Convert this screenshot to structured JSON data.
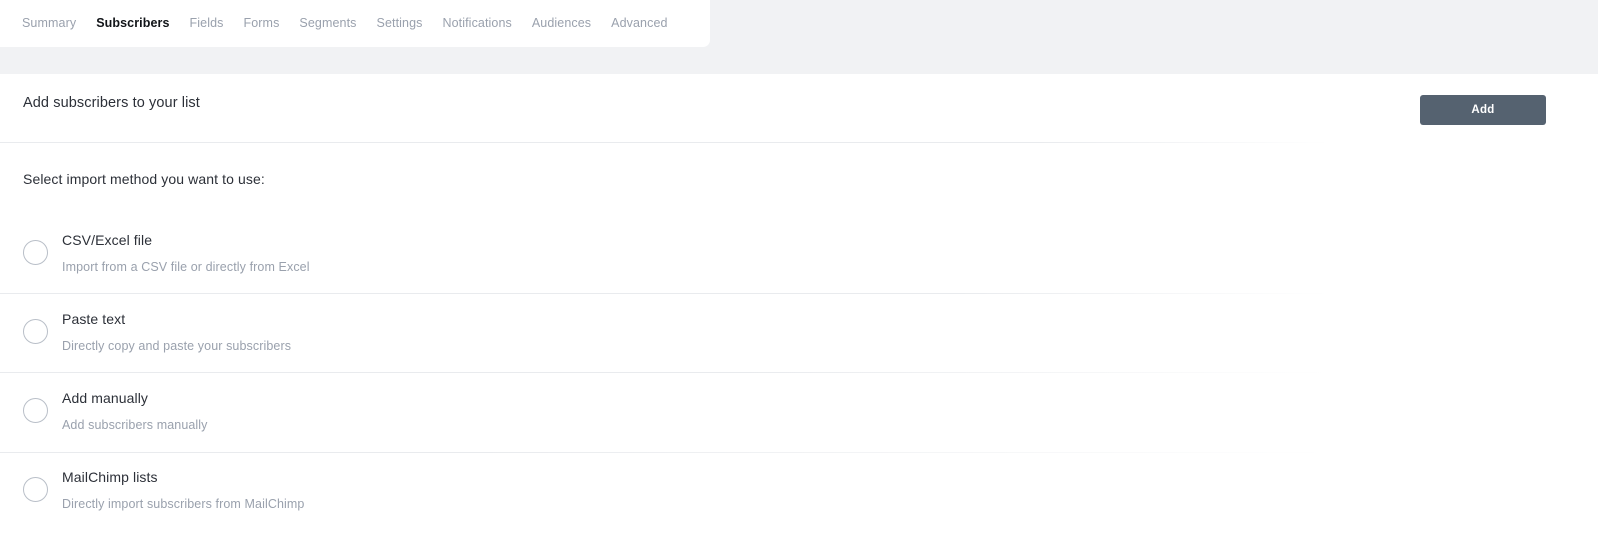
{
  "tabs": [
    {
      "label": "Summary",
      "active": false
    },
    {
      "label": "Subscribers",
      "active": true
    },
    {
      "label": "Fields",
      "active": false
    },
    {
      "label": "Forms",
      "active": false
    },
    {
      "label": "Segments",
      "active": false
    },
    {
      "label": "Settings",
      "active": false
    },
    {
      "label": "Notifications",
      "active": false
    },
    {
      "label": "Audiences",
      "active": false
    },
    {
      "label": "Advanced",
      "active": false
    }
  ],
  "header": {
    "title": "Add subscribers to your list",
    "add_label": "Add"
  },
  "import": {
    "section_label": "Select import method you want to use:",
    "options": [
      {
        "title": "CSV/Excel file",
        "description": "Import from a CSV file or directly from Excel",
        "selected": false
      },
      {
        "title": "Paste text",
        "description": "Directly copy and paste your subscribers",
        "selected": false
      },
      {
        "title": "Add manually",
        "description": "Add subscribers manually",
        "selected": false
      },
      {
        "title": "MailChimp lists",
        "description": "Directly import subscribers from MailChimp",
        "selected": false
      }
    ]
  },
  "colors": {
    "band_background": "#f1f2f4",
    "button_background": "#556270",
    "text_primary": "#2c3038",
    "text_muted": "#9aa1ad",
    "rule": "#e9ebee",
    "radio_border": "#b9bfc8"
  }
}
